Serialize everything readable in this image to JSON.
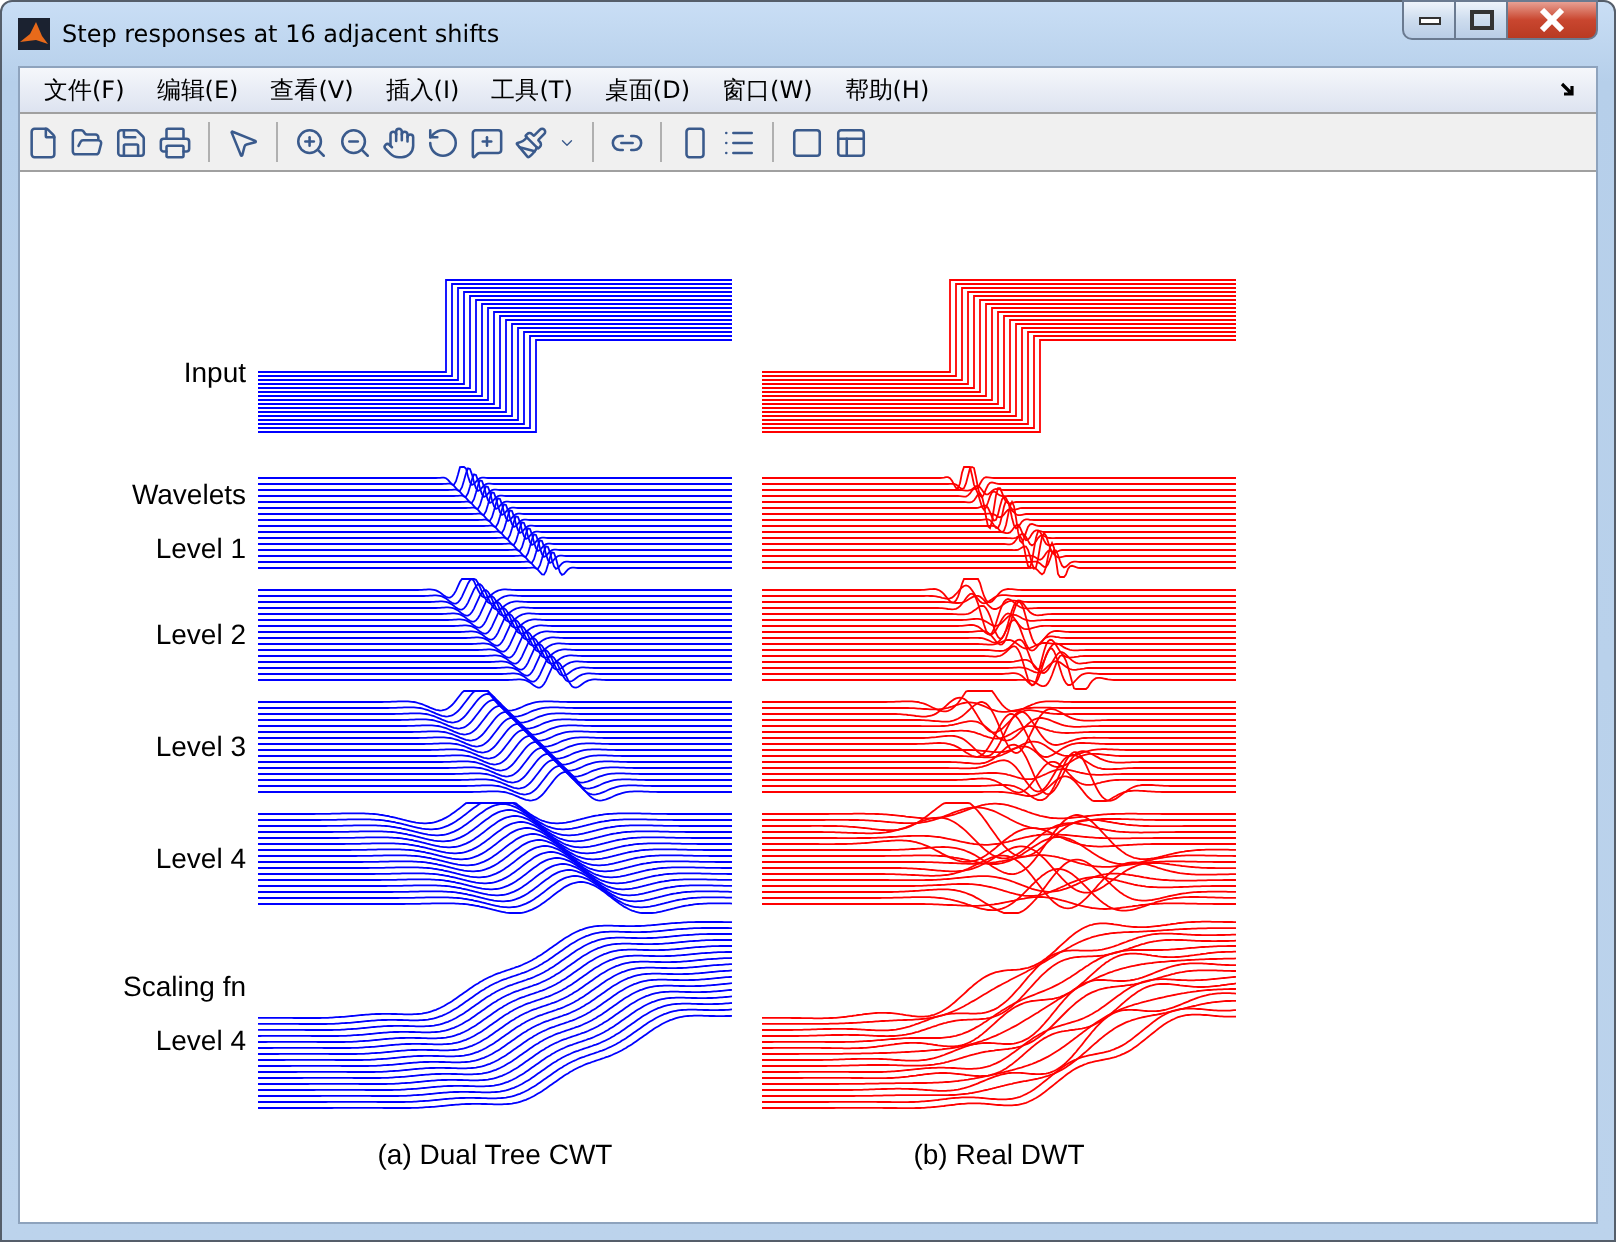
{
  "window": {
    "title": "Step responses at 16 adjacent shifts"
  },
  "menu": [
    "文件(F)",
    "编辑(E)",
    "查看(V)",
    "插入(I)",
    "工具(T)",
    "桌面(D)",
    "窗口(W)",
    "帮助(H)"
  ],
  "figure": {
    "panels": [
      {
        "caption": "(a) Dual Tree CWT",
        "color": "#0000ff",
        "kind": "cwt"
      },
      {
        "caption": "(b) Real DWT",
        "color": "#ff0000",
        "kind": "dwt"
      }
    ],
    "rows": [
      {
        "kind": "step",
        "labels": [
          "Input"
        ]
      },
      {
        "kind": "wavelet",
        "labels": [
          "Wavelets",
          "Level 1"
        ]
      },
      {
        "kind": "wavelet",
        "labels": [
          "Level 2"
        ]
      },
      {
        "kind": "wavelet",
        "labels": [
          "Level 3"
        ]
      },
      {
        "kind": "wavelet",
        "labels": [
          "Level 4"
        ]
      },
      {
        "kind": "scaling",
        "labels": [
          "Scaling fn",
          "Level 4"
        ]
      }
    ]
  }
}
